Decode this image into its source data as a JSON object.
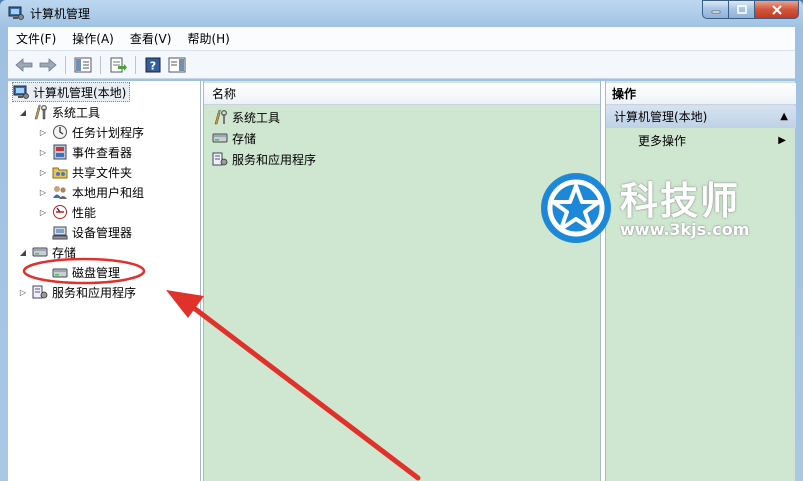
{
  "window": {
    "title": "计算机管理",
    "caption": {
      "min": "—",
      "max": "□",
      "close": "✕"
    }
  },
  "menu": [
    "文件(F)",
    "操作(A)",
    "查看(V)",
    "帮助(H)"
  ],
  "tree": [
    {
      "label": "计算机管理(本地)",
      "icon": "computer-management-icon",
      "expander": ""
    },
    {
      "label": "系统工具",
      "icon": "system-tools-icon",
      "expander": "◢"
    },
    {
      "label": "任务计划程序",
      "icon": "task-scheduler-icon",
      "expander": "▷"
    },
    {
      "label": "事件查看器",
      "icon": "event-viewer-icon",
      "expander": "▷"
    },
    {
      "label": "共享文件夹",
      "icon": "shared-folder-icon",
      "expander": "▷"
    },
    {
      "label": "本地用户和组",
      "icon": "users-groups-icon",
      "expander": "▷"
    },
    {
      "label": "性能",
      "icon": "performance-icon",
      "expander": "▷"
    },
    {
      "label": "设备管理器",
      "icon": "device-manager-icon",
      "expander": ""
    },
    {
      "label": "存储",
      "icon": "storage-icon",
      "expander": "◢"
    },
    {
      "label": "磁盘管理",
      "icon": "disk-management-icon",
      "expander": ""
    },
    {
      "label": "服务和应用程序",
      "icon": "services-apps-icon",
      "expander": "▷"
    }
  ],
  "center": {
    "column_header": "名称",
    "items": [
      "系统工具",
      "存储",
      "服务和应用程序"
    ]
  },
  "actions": {
    "header": "操作",
    "section": "计算机管理(本地)",
    "section_arrow": "▲",
    "item": "更多操作",
    "item_arrow": "▶"
  },
  "watermark": {
    "brand": "科技师",
    "url": "www.3kjs.com"
  },
  "colors": {
    "annotation": "#e0322a",
    "pane_bg": "#cfe7d0",
    "brand_blue": "#1e88d8"
  }
}
